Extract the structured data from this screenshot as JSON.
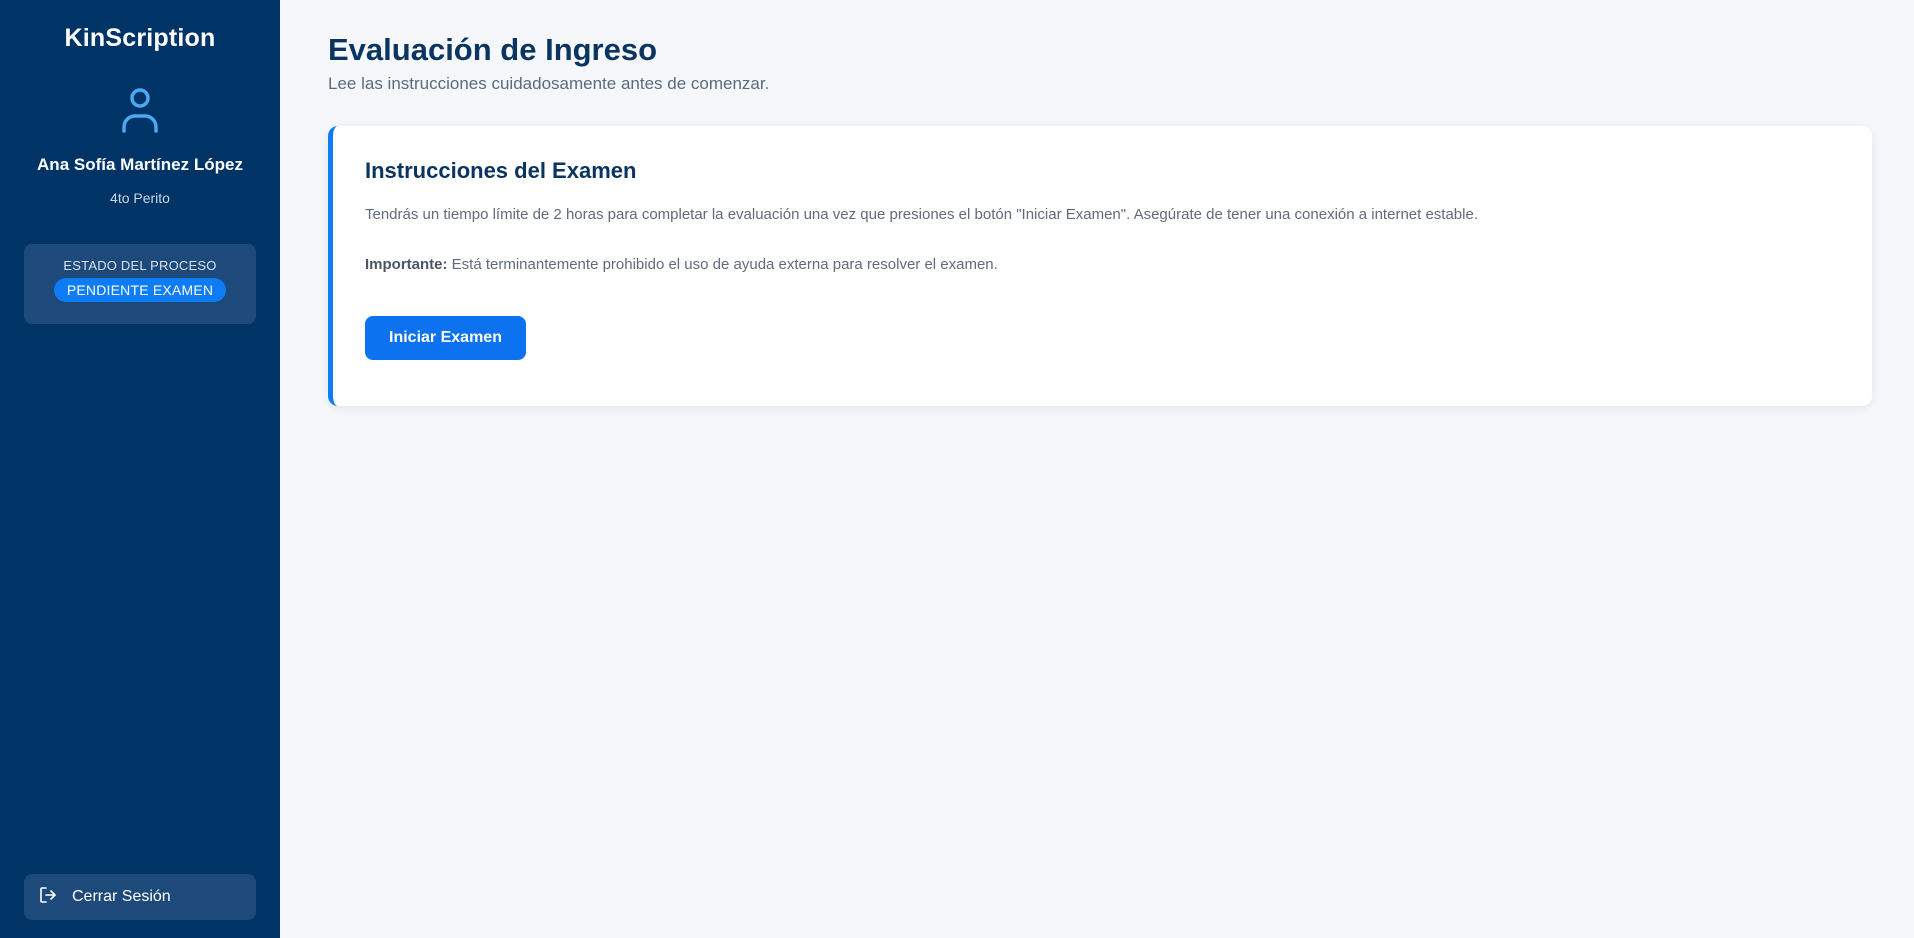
{
  "sidebar": {
    "brand": "KinScription",
    "user_icon": "user-icon",
    "user_name": "Ana Sofía Martínez López",
    "user_role": "4to Perito",
    "status": {
      "title": "ESTADO DEL PROCESO",
      "badge": "PENDIENTE EXAMEN"
    },
    "logout": {
      "icon": "logout-icon",
      "label": "Cerrar Sesión"
    }
  },
  "main": {
    "title": "Evaluación de Ingreso",
    "subtitle": "Lee las instrucciones cuidadosamente antes de comenzar.",
    "card": {
      "title": "Instrucciones del Examen",
      "paragraph1": "Tendrás un tiempo límite de 2 horas para completar la evaluación una vez que presiones el botón \"Iniciar Examen\". Asegúrate de tener una conexión a internet estable.",
      "important_label": "Importante:",
      "important_text": " Está terminantemente prohibido el uso de ayuda externa para resolver el examen.",
      "button_label": "Iniciar Examen"
    }
  },
  "colors": {
    "sidebar_bg": "#003366",
    "accent": "#0d7cf5",
    "title": "#0a3561"
  }
}
